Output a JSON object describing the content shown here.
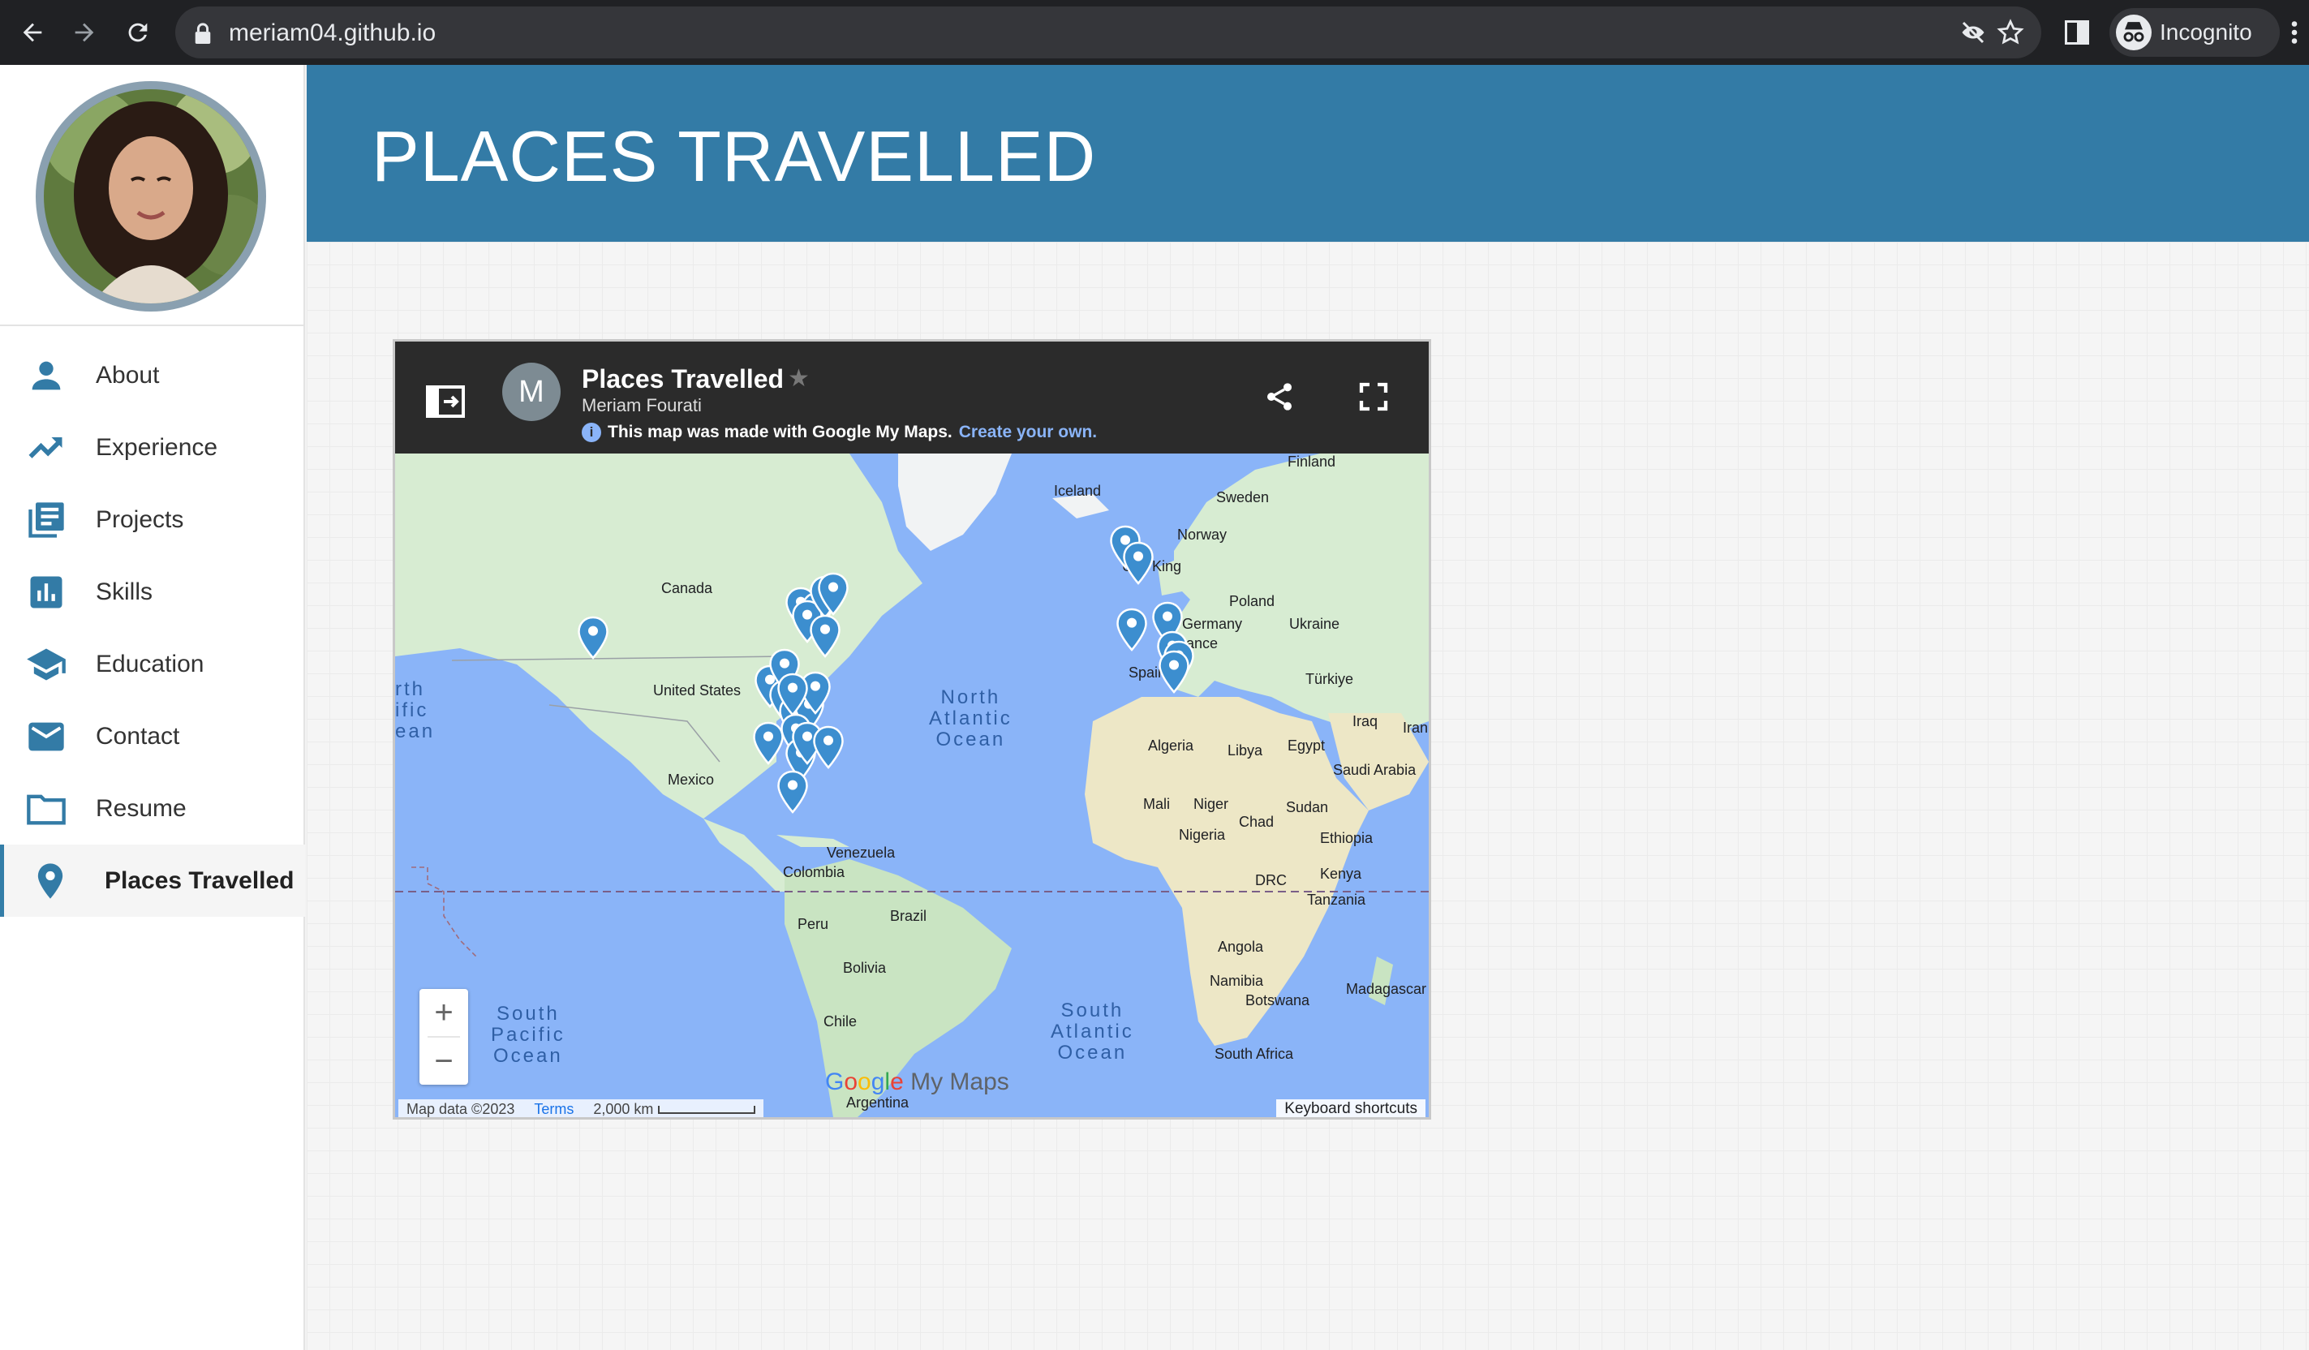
{
  "browser": {
    "url": "meriam04.github.io",
    "profile_label": "Incognito",
    "icons": [
      "back-icon",
      "forward-icon",
      "reload-icon",
      "lock-icon",
      "eye-off-icon",
      "star-icon",
      "side-panel-icon",
      "incognito-icon",
      "more-vert-icon"
    ]
  },
  "sidebar": {
    "items": [
      {
        "label": "About",
        "icon": "person-icon"
      },
      {
        "label": "Experience",
        "icon": "trending-up-icon"
      },
      {
        "label": "Projects",
        "icon": "library-books-icon"
      },
      {
        "label": "Skills",
        "icon": "bar-chart-icon"
      },
      {
        "label": "Education",
        "icon": "school-icon"
      },
      {
        "label": "Contact",
        "icon": "email-icon"
      },
      {
        "label": "Resume",
        "icon": "folder-icon"
      },
      {
        "label": "Places Travelled",
        "icon": "location-pin-icon",
        "active": true
      }
    ]
  },
  "header": {
    "title": "PLACES TRAVELLED"
  },
  "map": {
    "title": "Places Travelled",
    "author": "Meriam Fourati",
    "avatar_letter": "M",
    "info_text": "This map was made with Google My Maps.",
    "info_link": "Create your own.",
    "logo_text": "Google My Maps",
    "attribution": "Map data ©2023",
    "terms": "Terms",
    "scale": "2,000 km",
    "keyboard_shortcuts": "Keyboard shortcuts",
    "zoom_in": "+",
    "zoom_out": "−",
    "labels": {
      "finland": "Finland",
      "sweden": "Sweden",
      "iceland": "Iceland",
      "norway": "Norway",
      "uk": "Unit\nKing",
      "poland": "Poland",
      "germany": "Germany",
      "ukraine": "Ukraine",
      "france": "France",
      "spain": "Spain",
      "turkiye": "Türkiye",
      "iraq": "Iraq",
      "iran": "Iran",
      "algeria": "Algeria",
      "libya": "Libya",
      "egypt": "Egypt",
      "saudi": "Saudi Arabia",
      "mali": "Mali",
      "niger": "Niger",
      "chad": "Chad",
      "sudan": "Sudan",
      "nigeria": "Nigeria",
      "ethiopia": "Ethiopia",
      "kenya": "Kenya",
      "drc": "DRC",
      "tanzania": "Tanzania",
      "angola": "Angola",
      "namibia": "Namibia",
      "botswana": "Botswana",
      "madagascar": "Madagascar",
      "south_africa": "South Africa",
      "canada": "Canada",
      "united_states": "United States",
      "mexico": "Mexico",
      "venezuela": "Venezuela",
      "colombia": "Colombia",
      "peru": "Peru",
      "brazil": "Brazil",
      "bolivia": "Bolivia",
      "chile": "Chile",
      "argentina": "Argentina"
    },
    "oceans": {
      "north_atlantic": "North\nAtlantic\nOcean",
      "south_atlantic": "South\nAtlantic\nOcean",
      "south_pacific": "South\nPacific\nOcean",
      "north_pacific": "rth\nific\nean"
    },
    "pin_color": "#3c8ecf",
    "water_color": "#8ab4f8",
    "land_color": "#d7ecd2"
  },
  "colors": {
    "accent": "#337ba6"
  }
}
